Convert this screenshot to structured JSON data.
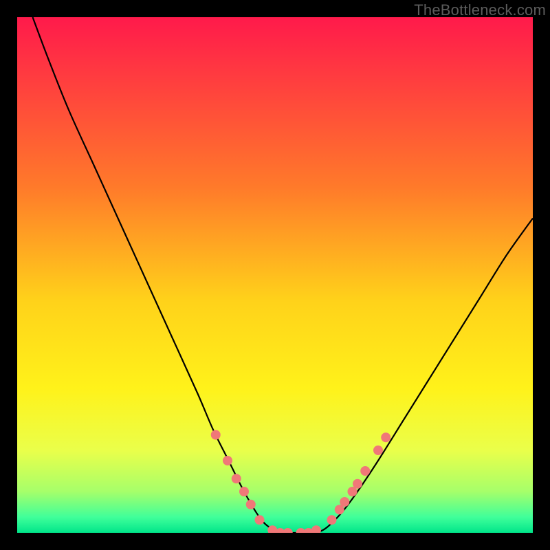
{
  "attribution": "TheBottleneck.com",
  "chart_data": {
    "type": "line",
    "title": "",
    "xlabel": "",
    "ylabel": "",
    "xlim": [
      0,
      100
    ],
    "ylim": [
      0,
      100
    ],
    "gradient_stops": [
      {
        "offset": 0,
        "color": "#ff1a4b"
      },
      {
        "offset": 33,
        "color": "#ff7a2a"
      },
      {
        "offset": 55,
        "color": "#ffd21a"
      },
      {
        "offset": 72,
        "color": "#fff21a"
      },
      {
        "offset": 84,
        "color": "#eaff4a"
      },
      {
        "offset": 92,
        "color": "#a6ff6a"
      },
      {
        "offset": 97,
        "color": "#3fff9a"
      },
      {
        "offset": 100,
        "color": "#00e58a"
      }
    ],
    "series": [
      {
        "name": "curve",
        "stroke": "#000000",
        "x": [
          3,
          6,
          10,
          15,
          20,
          25,
          30,
          35,
          38,
          41,
          44,
          47,
          49,
          51,
          53,
          55,
          57,
          58,
          60,
          63,
          66,
          70,
          75,
          80,
          85,
          90,
          95,
          100
        ],
        "y": [
          100,
          92,
          82,
          71,
          60,
          49,
          38,
          27,
          20,
          14,
          8,
          3,
          1,
          0,
          0,
          0,
          0,
          0,
          1,
          4,
          8,
          14,
          22,
          30,
          38,
          46,
          54,
          61
        ]
      }
    ],
    "markers": {
      "color": "#f07878",
      "radius": 7,
      "points": [
        {
          "x": 38.5,
          "y": 19
        },
        {
          "x": 40.8,
          "y": 14
        },
        {
          "x": 42.5,
          "y": 10.5
        },
        {
          "x": 44,
          "y": 8
        },
        {
          "x": 45.3,
          "y": 5.5
        },
        {
          "x": 47,
          "y": 2.5
        },
        {
          "x": 49.5,
          "y": 0.5
        },
        {
          "x": 51,
          "y": 0
        },
        {
          "x": 52.5,
          "y": 0
        },
        {
          "x": 55,
          "y": 0
        },
        {
          "x": 56.5,
          "y": 0
        },
        {
          "x": 58,
          "y": 0.5
        },
        {
          "x": 61,
          "y": 2.5
        },
        {
          "x": 62.5,
          "y": 4.5
        },
        {
          "x": 63.5,
          "y": 6
        },
        {
          "x": 65,
          "y": 8
        },
        {
          "x": 66,
          "y": 9.5
        },
        {
          "x": 67.5,
          "y": 12
        },
        {
          "x": 70,
          "y": 16
        },
        {
          "x": 71.5,
          "y": 18.5
        }
      ]
    }
  }
}
